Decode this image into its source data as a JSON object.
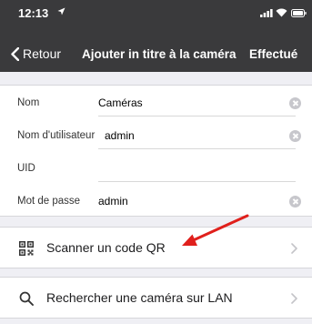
{
  "status_bar": {
    "time": "12:13"
  },
  "nav": {
    "back_label": "Retour",
    "title": "Ajouter in titre à la caméra",
    "done_label": "Effectué"
  },
  "form": {
    "fields": [
      {
        "label": "Nom",
        "value": "Caméras"
      },
      {
        "label": "Nom d'utilisateur",
        "value": "admin"
      },
      {
        "label": "UID",
        "value": ""
      },
      {
        "label": "Mot de passe",
        "value": "admin"
      }
    ]
  },
  "actions": {
    "scan_qr": "Scanner un code QR",
    "search_lan": "Rechercher une caméra sur LAN"
  },
  "colors": {
    "header_bg": "#3a3a3c",
    "page_bg": "#efeff4",
    "annotation_arrow": "#e0201c"
  }
}
